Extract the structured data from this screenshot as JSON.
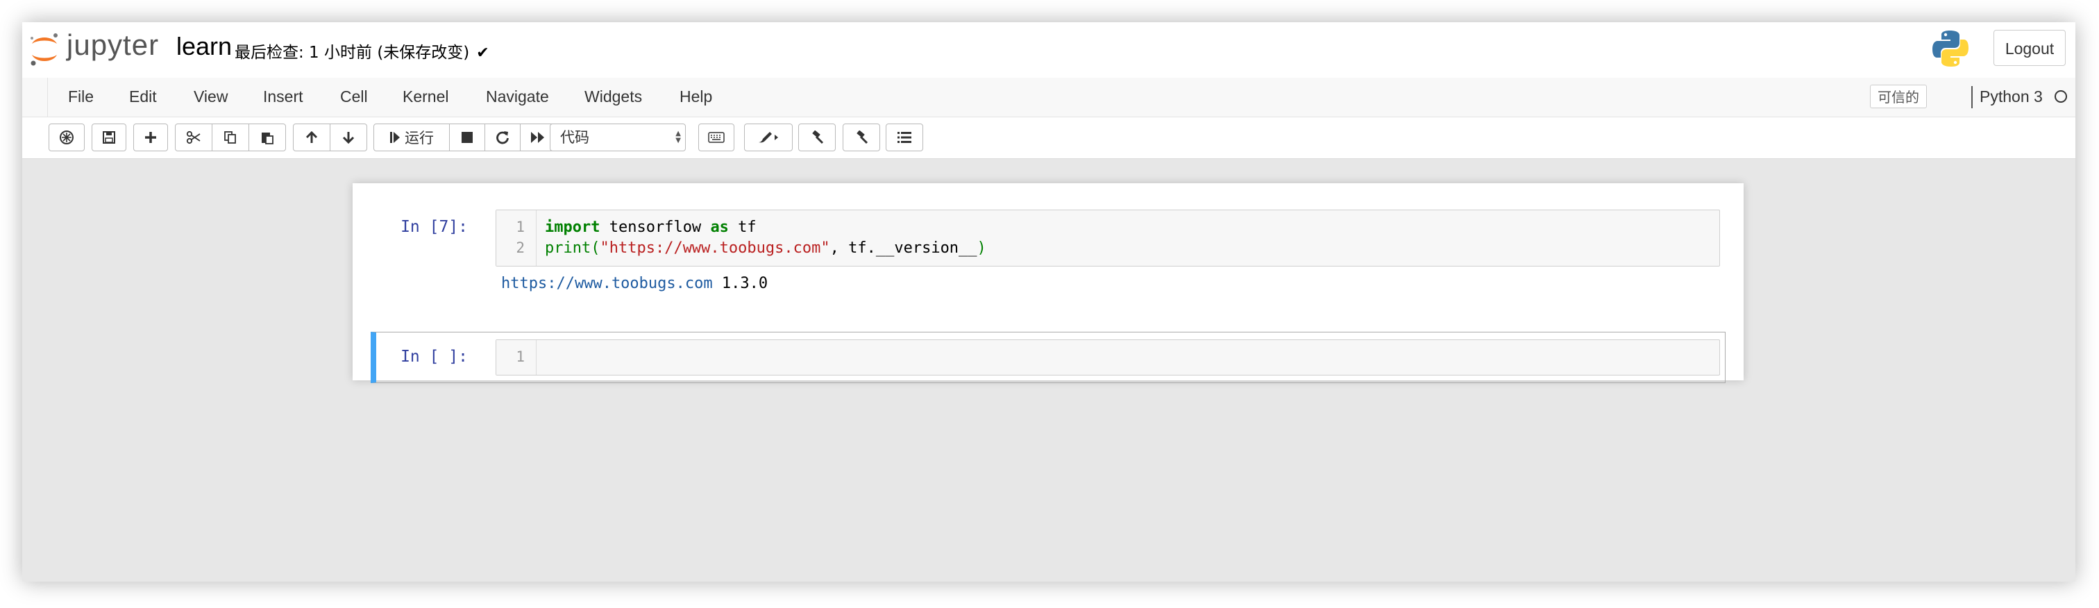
{
  "header": {
    "logo_text": "jupyter",
    "notebook_name": "learn",
    "checkpoint_text": "最后检查: 1 小时前  (未保存改变)",
    "logout_label": "Logout"
  },
  "menu": {
    "items": [
      "File",
      "Edit",
      "View",
      "Insert",
      "Cell",
      "Kernel",
      "Navigate",
      "Widgets",
      "Help"
    ],
    "trusted_label": "可信的",
    "kernel_name": "Python 3"
  },
  "toolbar": {
    "run_label": "运行",
    "cell_type": "代码",
    "buttons": [
      "save",
      "add-cell",
      "cut",
      "copy",
      "paste",
      "move-up",
      "move-down",
      "run",
      "interrupt",
      "restart",
      "restart-run-all",
      "cell-type",
      "keyboard",
      "ext-1",
      "ext-2",
      "ext-3",
      "toc"
    ]
  },
  "cells": [
    {
      "prompt": "In [7]:",
      "line_numbers": [
        "1",
        "2"
      ],
      "code": {
        "line1_kw1": "import",
        "line1_mid": " tensorflow ",
        "line1_kw2": "as",
        "line1_end": " tf",
        "line2_fn": "print",
        "line2_open": "(",
        "line2_str": "\"https://www.toobugs.com\"",
        "line2_mid": ", tf.__version__",
        "line2_close": ")"
      },
      "output_url": "https://www.toobugs.com",
      "output_rest": " 1.3.0"
    },
    {
      "prompt": "In [ ]:",
      "line_numbers": [
        "1"
      ]
    }
  ]
}
